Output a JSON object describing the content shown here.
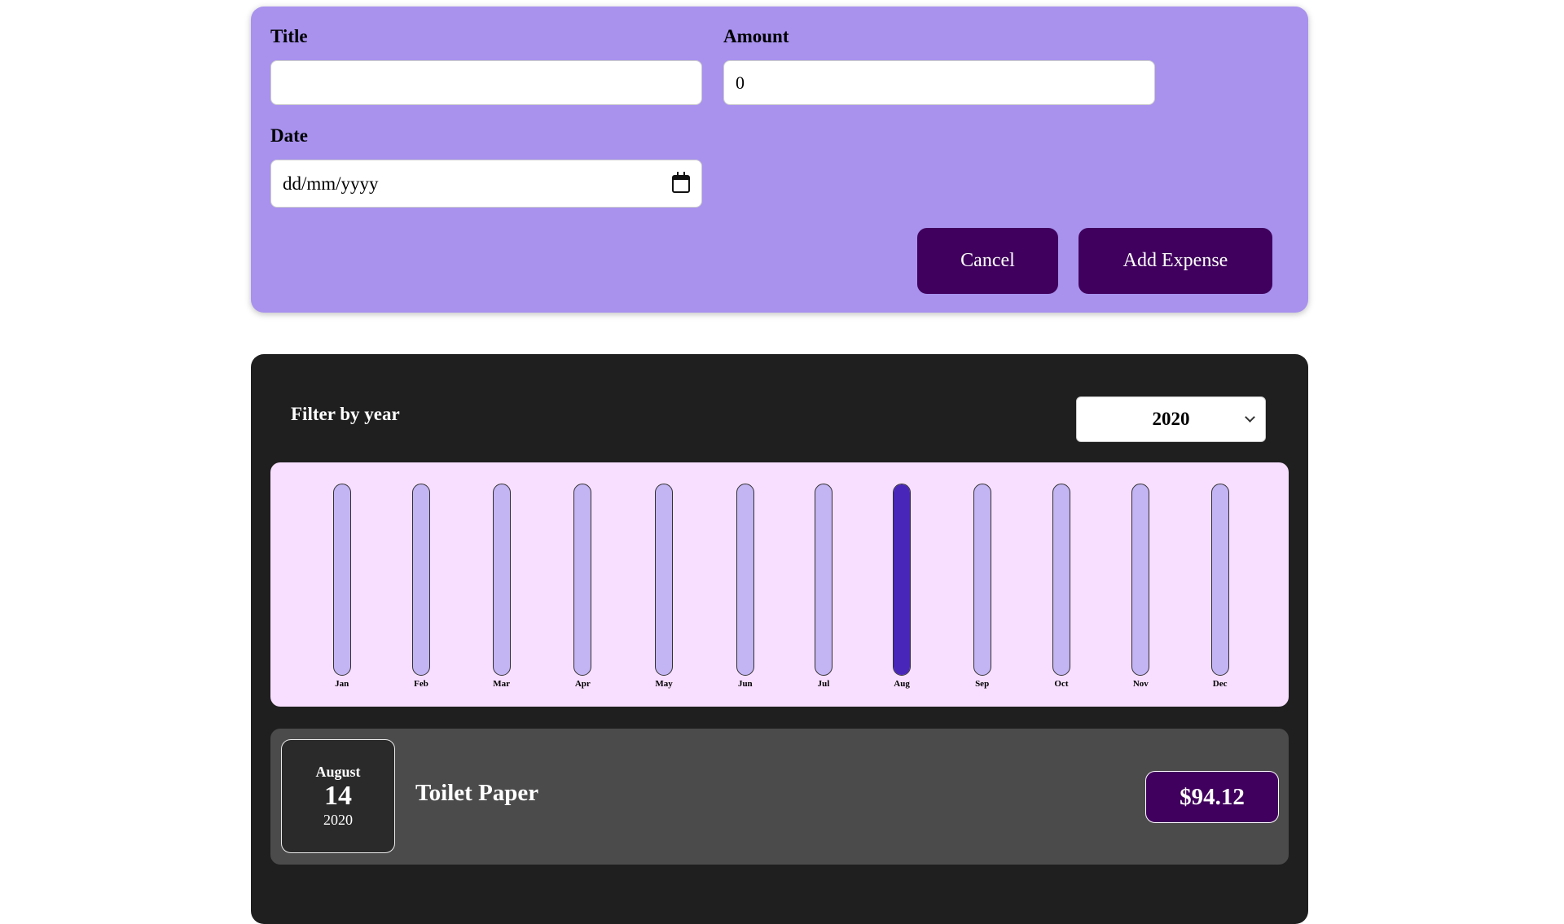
{
  "form": {
    "title_label": "Title",
    "title_value": "",
    "amount_label": "Amount",
    "amount_value": "0",
    "date_label": "Date",
    "date_placeholder": "dd/mm/yyyy",
    "cancel_label": "Cancel",
    "add_label": "Add Expense"
  },
  "filter": {
    "label": "Filter by year",
    "selected_year": "2020"
  },
  "colors": {
    "form_bg": "#a892ee",
    "button_bg": "#40005d",
    "panel_bg": "#1f1f1f",
    "chart_bg": "#f8dfff",
    "bar_empty": "#c3b4f3",
    "bar_fill": "#4826b9",
    "item_bg": "#4b4b4b"
  },
  "chart_data": {
    "type": "bar",
    "categories": [
      "Jan",
      "Feb",
      "Mar",
      "Apr",
      "May",
      "Jun",
      "Jul",
      "Aug",
      "Sep",
      "Oct",
      "Nov",
      "Dec"
    ],
    "values": [
      0,
      0,
      0,
      0,
      0,
      0,
      0,
      94.12,
      0,
      0,
      0,
      0
    ],
    "max": 94.12
  },
  "expenses": [
    {
      "month": "August",
      "day": "14",
      "year": "2020",
      "title": "Toilet Paper",
      "amount": "$94.12"
    }
  ]
}
